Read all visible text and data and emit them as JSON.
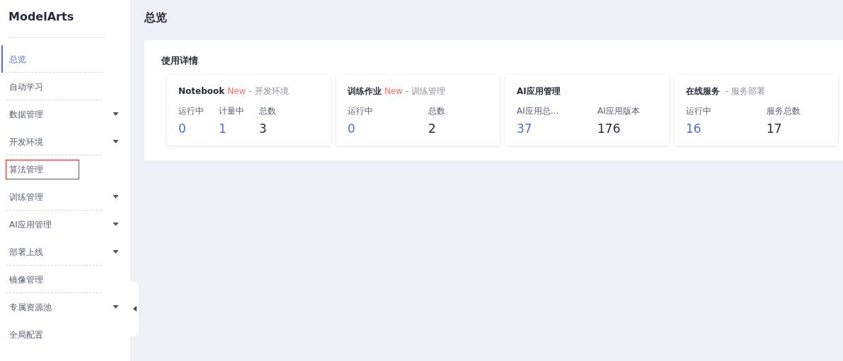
{
  "sidebar": {
    "logo": "ModelArts",
    "items": [
      {
        "label": "总览",
        "selected": true,
        "expandable": false,
        "divider_after": true,
        "highlighted": false
      },
      {
        "label": "自动学习",
        "selected": false,
        "expandable": false,
        "divider_after": true,
        "highlighted": false
      },
      {
        "label": "数据管理",
        "selected": false,
        "expandable": true,
        "divider_after": false,
        "highlighted": false
      },
      {
        "label": "开发环境",
        "selected": false,
        "expandable": true,
        "divider_after": true,
        "highlighted": false
      },
      {
        "label": "算法管理",
        "selected": false,
        "expandable": false,
        "divider_after": false,
        "highlighted": true
      },
      {
        "label": "训练管理",
        "selected": false,
        "expandable": true,
        "divider_after": true,
        "highlighted": false
      },
      {
        "label": "AI应用管理",
        "selected": false,
        "expandable": true,
        "divider_after": false,
        "highlighted": false
      },
      {
        "label": "部署上线",
        "selected": false,
        "expandable": true,
        "divider_after": true,
        "highlighted": false
      },
      {
        "label": "镜像管理",
        "selected": false,
        "expandable": false,
        "divider_after": true,
        "highlighted": false
      },
      {
        "label": "专属资源池",
        "selected": false,
        "expandable": true,
        "divider_after": false,
        "highlighted": false
      },
      {
        "label": "全局配置",
        "selected": false,
        "expandable": false,
        "divider_after": false,
        "highlighted": false
      }
    ]
  },
  "page_title": "总览",
  "panel": {
    "title": "使用详情",
    "cards": [
      {
        "title": "Notebook",
        "badge": "New",
        "subtitle": "- 开发环境",
        "stats": [
          {
            "label": "运行中",
            "value": "0",
            "kind": "active"
          },
          {
            "label": "计量中",
            "value": "1",
            "kind": "active"
          },
          {
            "label": "总数",
            "value": "3",
            "kind": "total"
          }
        ]
      },
      {
        "title": "训练作业",
        "badge": "New",
        "subtitle": "- 训练管理",
        "stats": [
          {
            "label": "运行中",
            "value": "0",
            "kind": "active"
          },
          {
            "label": "总数",
            "value": "2",
            "kind": "total"
          }
        ]
      },
      {
        "title": "AI应用管理",
        "stats": [
          {
            "label": "AI应用总...",
            "value": "37",
            "kind": "active"
          },
          {
            "label": "AI应用版本",
            "value": "176",
            "kind": "total"
          }
        ]
      },
      {
        "title": "在线服务",
        "subtitle": "- 服务部署",
        "stats": [
          {
            "label": "运行中",
            "value": "16",
            "kind": "active"
          },
          {
            "label": "服务总数",
            "value": "17",
            "kind": "total"
          }
        ]
      }
    ]
  }
}
